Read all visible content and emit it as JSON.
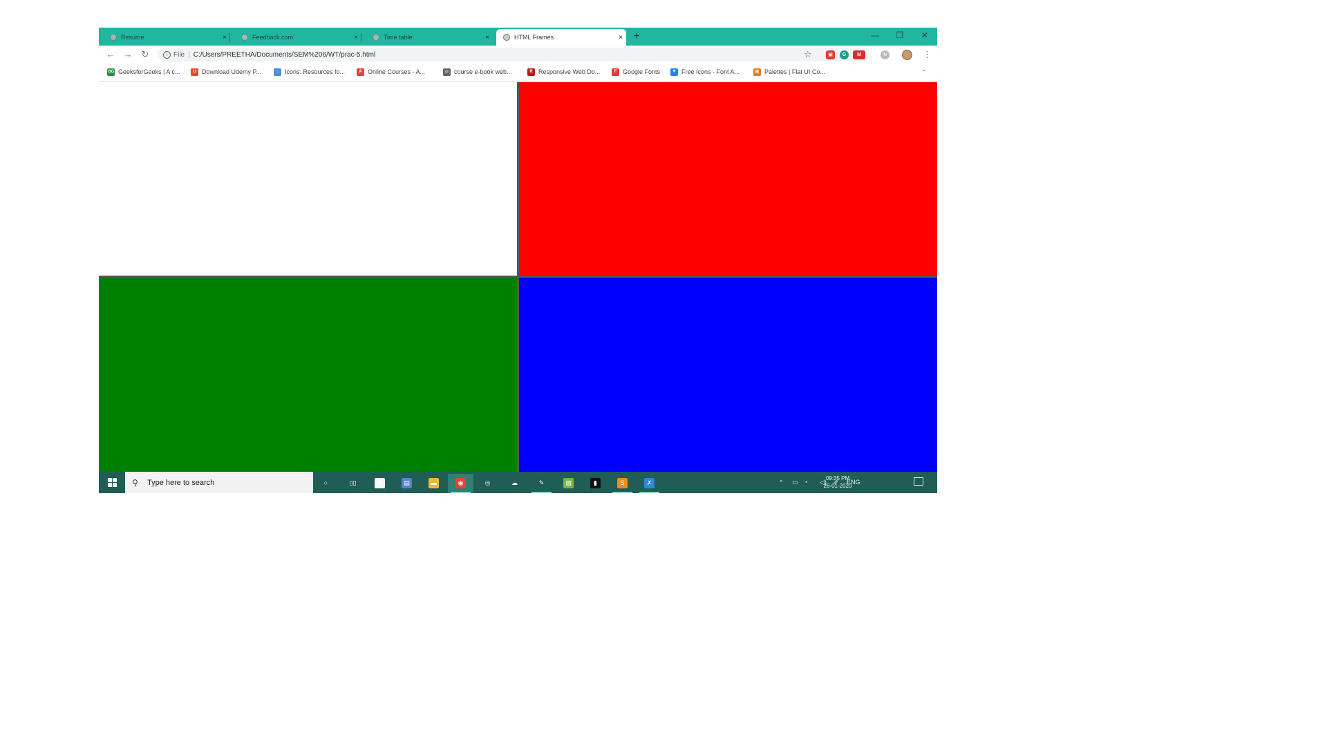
{
  "browser": {
    "tabs": [
      {
        "title": "Resume",
        "close": "×",
        "active": false
      },
      {
        "title": "Feedback.com",
        "close": "×",
        "active": false
      },
      {
        "title": "Time table",
        "close": "×",
        "active": false
      },
      {
        "title": "HTML Frames",
        "close": "×",
        "active": true
      }
    ],
    "new_tab": "+",
    "window_controls": {
      "minimize": "—",
      "maximize": "❐",
      "close": "✕"
    },
    "nav": {
      "back": "←",
      "forward": "→",
      "reload": "↻"
    },
    "address": {
      "scheme": "File",
      "url": "C:/Users/PREETHA/Documents/SEM%206/WT/prac-5.html"
    },
    "star": "☆",
    "menu": "⋮",
    "bookmarks": [
      {
        "label": "GeeksforGeeks | A c...",
        "icon": "geeksforgeeks-icon",
        "glyph": "GG",
        "color": "#2f8d46"
      },
      {
        "label": "Download Udemy P...",
        "icon": "udemy-icon",
        "glyph": "U",
        "color": "#e04a2b"
      },
      {
        "label": "Icons: Resources fo...",
        "icon": "icons-resource-icon",
        "glyph": "◌",
        "color": "#4a90d9"
      },
      {
        "label": "Online Courses - A...",
        "icon": "online-courses-icon",
        "glyph": "A",
        "color": "#d44"
      },
      {
        "label": "course e-book web...",
        "icon": "globe-icon",
        "glyph": "◎",
        "color": "#666"
      },
      {
        "label": "Responsive Web Do...",
        "icon": "responsive-web-icon",
        "glyph": "R",
        "color": "#b71c1c"
      },
      {
        "label": "Google Fonts",
        "icon": "google-fonts-icon",
        "glyph": "F",
        "color": "#e53935"
      },
      {
        "label": "Free Icons - Font A...",
        "icon": "font-awesome-icon",
        "glyph": "⚑",
        "color": "#1e88e5"
      },
      {
        "label": "Palettes | Flat UI Co...",
        "icon": "flat-ui-icon",
        "glyph": "▦",
        "color": "#e67e22"
      }
    ],
    "bookmarks_more": "⌄"
  },
  "frames": [
    {
      "name": "top-left-frame",
      "color": "#ffffff"
    },
    {
      "name": "top-right-frame",
      "color": "#ff0000"
    },
    {
      "name": "bottom-left-frame",
      "color": "#008000"
    },
    {
      "name": "bottom-right-frame",
      "color": "#0000ff"
    }
  ],
  "taskbar": {
    "search_placeholder": "Type here to search",
    "search_glyph": "⚲",
    "apps": [
      {
        "name": "cortana-icon",
        "glyph": "○",
        "color": "transparent",
        "active": false,
        "underline": false
      },
      {
        "name": "task-view-icon",
        "glyph": "▯▯",
        "color": "transparent",
        "active": false,
        "underline": false
      },
      {
        "name": "store-icon",
        "glyph": "🛍",
        "color": "#f4f4f4",
        "active": false,
        "underline": false
      },
      {
        "name": "document-app-icon",
        "glyph": "▤",
        "color": "#5b7fd6",
        "active": false,
        "underline": false
      },
      {
        "name": "file-explorer-icon",
        "glyph": "▬",
        "color": "#e8b93a",
        "active": false,
        "underline": false
      },
      {
        "name": "chrome-icon",
        "glyph": "◉",
        "color": "#e94335",
        "active": true,
        "underline": true
      },
      {
        "name": "settings-app-icon",
        "glyph": "◎",
        "color": "transparent",
        "active": false,
        "underline": false
      },
      {
        "name": "chat-app-icon",
        "glyph": "☁",
        "color": "transparent",
        "active": false,
        "underline": false
      },
      {
        "name": "paint-app-icon",
        "glyph": "✎",
        "color": "transparent",
        "active": false,
        "underline": true
      },
      {
        "name": "image-app-icon",
        "glyph": "▧",
        "color": "#7bb241",
        "active": false,
        "underline": false
      },
      {
        "name": "terminal-icon",
        "glyph": "▮",
        "color": "#111111",
        "active": false,
        "underline": false
      },
      {
        "name": "sublime-text-icon",
        "glyph": "S",
        "color": "#f08c1a",
        "active": false,
        "underline": true
      },
      {
        "name": "vscode-icon",
        "glyph": "✗",
        "color": "#2a8ad8",
        "active": false,
        "underline": true
      }
    ],
    "tray": {
      "chevron": "^",
      "battery": "▭",
      "wifi": "◔",
      "volume": "◁)",
      "pen": "✐",
      "language": "ENG",
      "time": "09:35 PM",
      "date": "26-01-2020"
    }
  }
}
